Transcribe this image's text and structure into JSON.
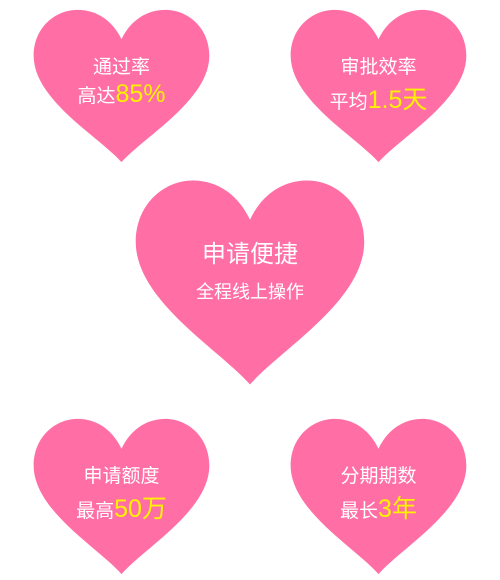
{
  "colors": {
    "heart": "#ff6fa6",
    "highlight": "#fff100",
    "text": "#ffffff"
  },
  "hearts": [
    {
      "line1": "通过率",
      "line2_prefix": "高达",
      "line2_value": "85%"
    },
    {
      "line1": "审批效率",
      "line2_prefix": "平均",
      "line2_value": "1.5天"
    },
    {
      "line1": "申请便捷",
      "line2": "全程线上操作"
    },
    {
      "line1": "申请额度",
      "line2_prefix": "最高",
      "line2_value": "50万"
    },
    {
      "line1": "分期期数",
      "line2_prefix": "最长",
      "line2_value": "3年"
    }
  ]
}
